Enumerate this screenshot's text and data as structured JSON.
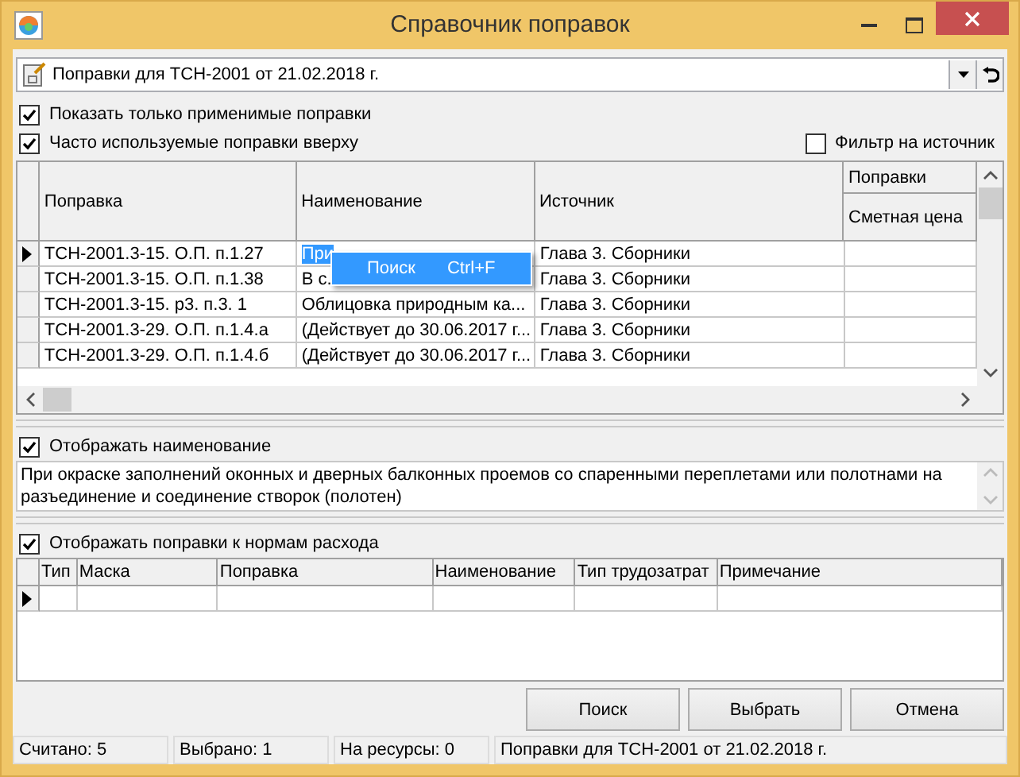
{
  "window": {
    "title": "Справочник поправок"
  },
  "set_selector": {
    "value": "Поправки для ТСН-2001 от 21.02.2018 г."
  },
  "options": [
    {
      "label": "Показать только применимые поправки",
      "checked": true
    },
    {
      "label": "Часто используемые поправки вверху",
      "checked": true
    }
  ],
  "source_filter": {
    "label": "Фильтр на источник",
    "checked": false
  },
  "corrections_table": {
    "columns": [
      "Поправка",
      "Наименование",
      "Источник"
    ],
    "group_column": {
      "group": "Поправки",
      "label": "Сметная цена"
    },
    "rows": [
      {
        "cells": [
          "ТСН-2001.3-15. О.П. п.1.27",
          "При",
          "Глава 3. Сборники",
          ""
        ],
        "selected": true
      },
      {
        "cells": [
          "ТСН-2001.3-15. О.П. п.1.38",
          "В с.",
          "Глава 3. Сборники",
          ""
        ],
        "selected": false
      },
      {
        "cells": [
          "ТСН-2001.3-15. р3. п.3. 1",
          "Облицовка природным ка...",
          "Глава 3. Сборники",
          ""
        ],
        "selected": false
      },
      {
        "cells": [
          "ТСН-2001.3-29. О.П. п.1.4.а",
          "(Действует до 30.06.2017 г...",
          "Глава 3. Сборники",
          ""
        ],
        "selected": false
      },
      {
        "cells": [
          "ТСН-2001.3-29. О.П. п.1.4.б",
          "(Действует до 30.06.2017 г...",
          "Глава 3. Сборники",
          ""
        ],
        "selected": false
      }
    ]
  },
  "context_menu": {
    "items": [
      {
        "label": "Поиск",
        "shortcut": "Ctrl+F"
      }
    ]
  },
  "show_name": {
    "label": "Отображать наименование",
    "checked": true
  },
  "name_text": "При окраске заполнений оконных и дверных балконных проемов со спаренными переплетами или полотнами на разъединение и соединение створок (полотен)",
  "show_norms": {
    "label": "Отображать поправки к нормам расхода",
    "checked": true
  },
  "norms_table": {
    "columns": [
      "Тип",
      "Маска",
      "Поправка",
      "Наименование",
      "Тип трудозатрат",
      "Примечание"
    ]
  },
  "buttons": [
    "Поиск",
    "Выбрать",
    "Отмена"
  ],
  "status_bar": [
    "Считано: 5",
    "Выбрано: 1",
    "На ресурсы: 0",
    "Поправки для ТСН-2001 от 21.02.2018 г."
  ]
}
